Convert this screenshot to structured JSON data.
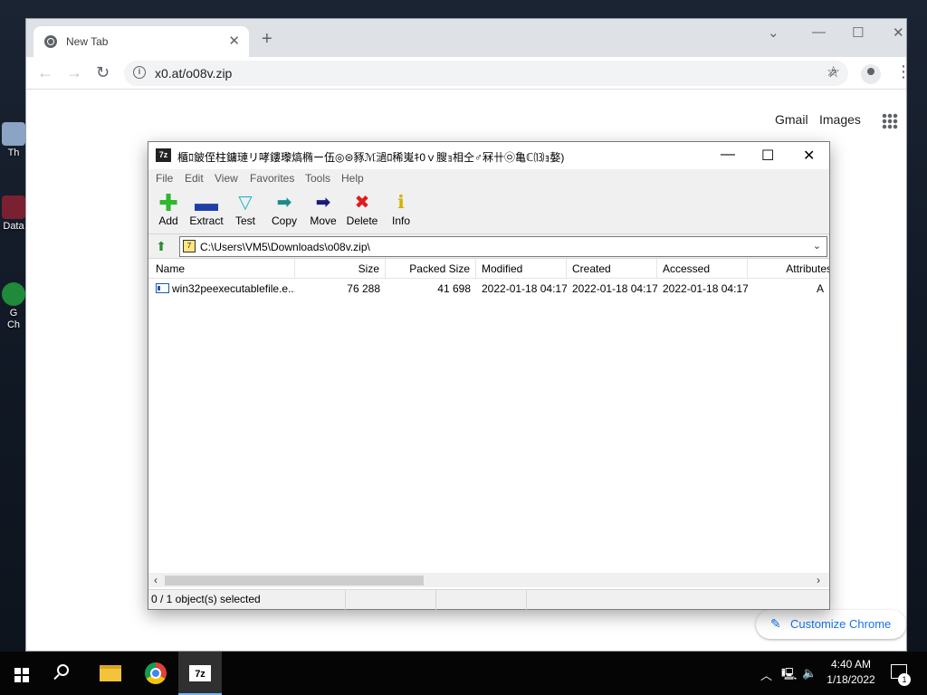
{
  "desktop": {
    "icons": [
      {
        "label": "Th",
        "icon": "recycle-bin-icon"
      },
      {
        "label": "Data",
        "icon": "shortcut-icon"
      },
      {
        "label": "G\nCh",
        "icon": "chrome-shortcut-icon"
      }
    ]
  },
  "browser": {
    "tab_title": "New Tab",
    "url": "x0.at/o08v.zip",
    "ntp_links": {
      "gmail": "Gmail",
      "images": "Images"
    },
    "customize_label": "Customize Chrome",
    "accent": "#1a73e8"
  },
  "zip": {
    "title": "櫃ﾛ鈹侄柱鏞璉リ哮鏤瓈熇椭ー伍◎⊜豩ℳ濄ﾛ稀嵬ｷ0ｖ膄ｮ相仝♂冧卄㉧亀ℂ⒀ｮ嫯)",
    "menu": [
      "File",
      "Edit",
      "View",
      "Favorites",
      "Tools",
      "Help"
    ],
    "toolbar": [
      {
        "label": "Add",
        "icon": "add-icon",
        "color": "#2db82d"
      },
      {
        "label": "Extract",
        "icon": "extract-icon",
        "color": "#1f3fa8"
      },
      {
        "label": "Test",
        "icon": "test-icon",
        "color": "#1fb7c9"
      },
      {
        "label": "Copy",
        "icon": "copy-icon",
        "color": "#1a8c8c"
      },
      {
        "label": "Move",
        "icon": "move-icon",
        "color": "#1a1a80"
      },
      {
        "label": "Delete",
        "icon": "delete-icon",
        "color": "#e01b1b"
      },
      {
        "label": "Info",
        "icon": "info-icon",
        "color": "#d4b000"
      }
    ],
    "path": "C:\\Users\\VM5\\Downloads\\o08v.zip\\",
    "columns": [
      "Name",
      "Size",
      "Packed Size",
      "Modified",
      "Created",
      "Accessed",
      "Attributes"
    ],
    "rows": [
      {
        "name": "win32peexecutablefile.e...",
        "size": "76 288",
        "packed": "41 698",
        "modified": "2022-01-18 04:17",
        "created": "2022-01-18 04:17",
        "accessed": "2022-01-18 04:17",
        "attributes": "A"
      }
    ],
    "status": "0 / 1 object(s) selected"
  },
  "taskbar": {
    "time": "4:40 AM",
    "date": "1/18/2022",
    "notification_count": "1"
  }
}
